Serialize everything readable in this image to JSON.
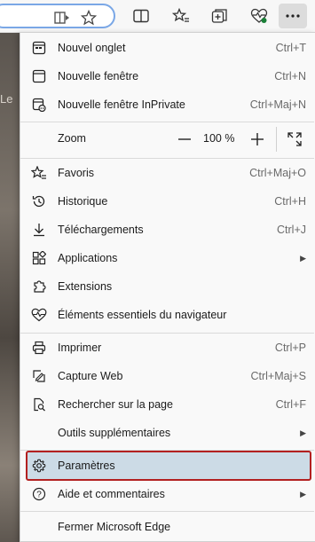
{
  "background": {
    "partial_text": "Le"
  },
  "menu": {
    "group1": [
      {
        "label": "Nouvel onglet",
        "shortcut": "Ctrl+T"
      },
      {
        "label": "Nouvelle fenêtre",
        "shortcut": "Ctrl+N"
      },
      {
        "label": "Nouvelle fenêtre InPrivate",
        "shortcut": "Ctrl+Maj+N"
      }
    ],
    "zoom": {
      "label": "Zoom",
      "minus": "—",
      "value": "100 %",
      "plus": "+"
    },
    "group2": [
      {
        "label": "Favoris",
        "shortcut": "Ctrl+Maj+O"
      },
      {
        "label": "Historique",
        "shortcut": "Ctrl+H"
      },
      {
        "label": "Téléchargements",
        "shortcut": "Ctrl+J"
      },
      {
        "label": "Applications",
        "shortcut": ""
      },
      {
        "label": "Extensions",
        "shortcut": ""
      },
      {
        "label": "Éléments essentiels du navigateur",
        "shortcut": ""
      }
    ],
    "group3": [
      {
        "label": "Imprimer",
        "shortcut": "Ctrl+P"
      },
      {
        "label": "Capture Web",
        "shortcut": "Ctrl+Maj+S"
      },
      {
        "label": "Rechercher sur la page",
        "shortcut": "Ctrl+F"
      },
      {
        "label": "Outils supplémentaires",
        "shortcut": ""
      }
    ],
    "group4": [
      {
        "label": "Paramètres",
        "shortcut": ""
      },
      {
        "label": "Aide et commentaires",
        "shortcut": ""
      }
    ],
    "group5": [
      {
        "label": "Fermer Microsoft Edge",
        "shortcut": ""
      }
    ]
  },
  "colors": {
    "highlight": "#ccdbe6",
    "highlight_border": "#b32020",
    "address_border": "#7aa7e6"
  }
}
